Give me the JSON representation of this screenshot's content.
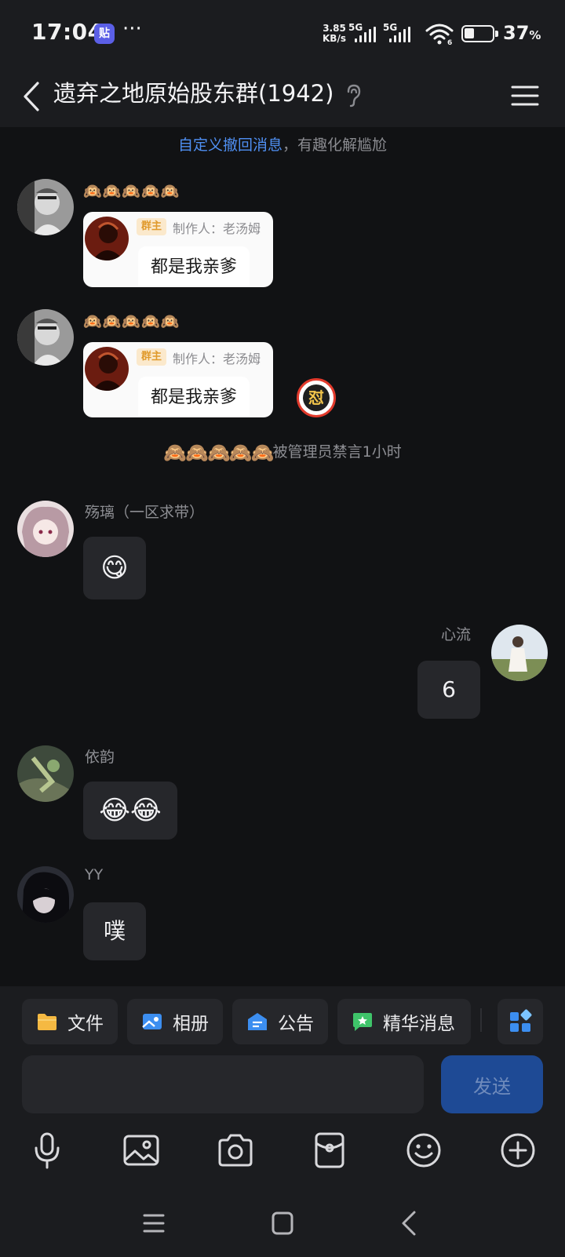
{
  "status_bar": {
    "time": "17:04",
    "app_badge": "贴",
    "more": "···",
    "net_speed_value": "3.85",
    "net_speed_unit": "KB/s",
    "sim1": "5G",
    "sim2": "5G",
    "wifi_label": "6",
    "battery": "37",
    "battery_unit": "%",
    "battery_level": 0.37
  },
  "header": {
    "title": "遗弃之地原始股东群(1942)",
    "back_icon": "chevron-left-icon",
    "ear_icon": "ear-icon",
    "menu_icon": "hamburger-menu-icon"
  },
  "tip_banner": {
    "link": "自定义撤回消息",
    "rest": "，有趣化解尴尬"
  },
  "messages": [
    {
      "emoji": "🙉🙉🙉🙉🙉",
      "card": {
        "badge": "群主",
        "maker": "制作人：老汤姆",
        "text": "都是我亲爹"
      }
    },
    {
      "emoji": "🙉🙉🙉🙉🙉",
      "card": {
        "badge": "群主",
        "maker": "制作人：老汤姆",
        "text": "都是我亲爹"
      },
      "sticker": "怼"
    },
    {
      "system": {
        "emoji": "🙈🙈🙈🙈🙈",
        "text": "被管理员禁言1小时"
      }
    },
    {
      "sender": "殇璃（一区求带）",
      "text": "😋"
    },
    {
      "sender": "心流",
      "text": "6"
    },
    {
      "sender": "依韵",
      "text": "😂😂"
    },
    {
      "sender": "YY",
      "text": "噗"
    }
  ],
  "quick_actions": [
    {
      "label": "文件",
      "icon": "folder-icon",
      "color": "#f5b942"
    },
    {
      "label": "相册",
      "icon": "album-icon",
      "color": "#3c8ef0"
    },
    {
      "label": "公告",
      "icon": "announcement-icon",
      "color": "#3c8ef0"
    },
    {
      "label": "精华消息",
      "icon": "featured-message-icon",
      "color": "#3fc46a"
    }
  ],
  "input": {
    "placeholder": "",
    "send_label": "发送"
  },
  "toolbar": [
    "microphone-icon",
    "image-icon",
    "camera-icon",
    "red-packet-icon",
    "emoji-icon",
    "plus-icon"
  ],
  "nav": [
    "recent-apps-icon",
    "home-icon",
    "back-icon"
  ],
  "colors": {
    "background": "#111214",
    "panel": "#1b1c1f",
    "bubble": "#26272b",
    "link": "#4f8ff2",
    "send_button": "#1e4a95",
    "owner_badge_bg": "#fbe9cc",
    "owner_badge_text": "#e09a2c"
  }
}
